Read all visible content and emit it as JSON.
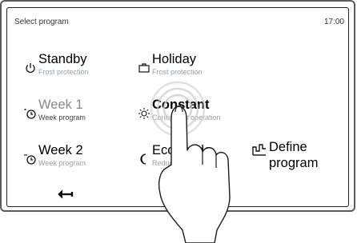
{
  "header": {
    "title": "Select program",
    "time": "17:00"
  },
  "programs": [
    {
      "name": "Standby",
      "sub": "Frost protection",
      "icon": "power-icon"
    },
    {
      "name": "Holiday",
      "sub": "Frost protection",
      "icon": "suitcase-icon"
    },
    {
      "name": "Week 1",
      "sub": "Week program",
      "icon": "clock-1-icon"
    },
    {
      "name": "Constant",
      "sub": "Continuous operation",
      "icon": "sun-icon"
    },
    {
      "name": "Week 2",
      "sub": "Week program",
      "icon": "clock-2-icon"
    },
    {
      "name": "Eco mode",
      "sub": "Reduced operation",
      "icon": "moon-icon"
    }
  ],
  "define": {
    "label": "Define program",
    "icon": "define-program-icon"
  },
  "nav": {
    "back_icon": "back-arrow-icon"
  },
  "overlay": {
    "icon": "pointing-hand-icon"
  }
}
